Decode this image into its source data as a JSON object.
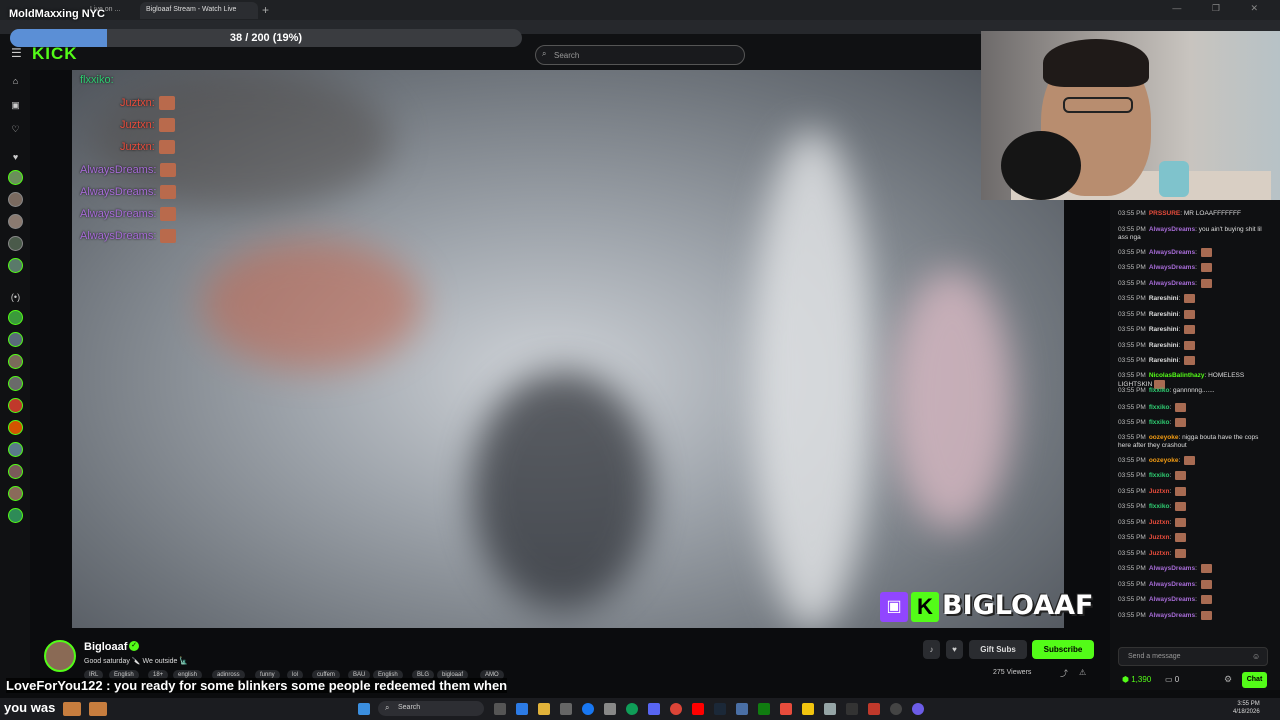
{
  "overlay": {
    "title": "MoldMaxxing NYC",
    "progress_label": "38 / 200 (19%)",
    "progress_fraction": 0.19
  },
  "browser": {
    "tabs": [
      {
        "label": "Live on ..."
      },
      {
        "label": "Bigloaaf Stream - Watch Live"
      }
    ],
    "new_tab": "+",
    "window_controls": "— ❐ ✕"
  },
  "kick": {
    "logo": "KICK",
    "search_placeholder": "Search"
  },
  "video_overlay_chat": [
    {
      "user": "flxxiko",
      "color": "#2ecc71",
      "suffix": ":"
    },
    {
      "user": "Juztxn",
      "color": "#e74c3c",
      "suffix": ":"
    },
    {
      "user": "Juztxn",
      "color": "#e74c3c",
      "suffix": ":"
    },
    {
      "user": "Juztxn",
      "color": "#e74c3c",
      "suffix": ":"
    },
    {
      "user": "AlwaysDreams",
      "color": "#9b59b6",
      "suffix": ":"
    },
    {
      "user": "AlwaysDreams",
      "color": "#9b59b6",
      "suffix": ":"
    },
    {
      "user": "AlwaysDreams",
      "color": "#9b59b6",
      "suffix": ":"
    },
    {
      "user": "AlwaysDreams",
      "color": "#9b59b6",
      "suffix": ":"
    }
  ],
  "video_badge": {
    "handle": "BIGLOAAF",
    "k": "K"
  },
  "chat": {
    "messages": [
      {
        "time": "03:55 PM",
        "user": "PRSSURE",
        "color": "#e74c3c",
        "text": "MR LOAAFFFFFFF",
        "emote": false
      },
      {
        "time": "03:55 PM",
        "user": "AlwaysDreams",
        "color": "#a66bd6",
        "text": "you ain't buying shit lil ass nga",
        "emote": false
      },
      {
        "time": "03:55 PM",
        "user": "AlwaysDreams",
        "color": "#a66bd6",
        "text": "",
        "emote": true
      },
      {
        "time": "03:55 PM",
        "user": "AlwaysDreams",
        "color": "#a66bd6",
        "text": "",
        "emote": true
      },
      {
        "time": "03:55 PM",
        "user": "AlwaysDreams",
        "color": "#a66bd6",
        "text": "",
        "emote": true
      },
      {
        "time": "03:55 PM",
        "user": "Rareshini",
        "color": "#dddddd",
        "text": "",
        "emote": true
      },
      {
        "time": "03:55 PM",
        "user": "Rareshini",
        "color": "#dddddd",
        "text": "",
        "emote": true
      },
      {
        "time": "03:55 PM",
        "user": "Rareshini",
        "color": "#dddddd",
        "text": "",
        "emote": true
      },
      {
        "time": "03:55 PM",
        "user": "Rareshini",
        "color": "#dddddd",
        "text": "",
        "emote": true
      },
      {
        "time": "03:55 PM",
        "user": "Rareshini",
        "color": "#dddddd",
        "text": "",
        "emote": true
      },
      {
        "time": "03:55 PM",
        "user": "NicolasBalinthazy",
        "color": "#53fc18",
        "text": "HOMELESS LIGHTSKIN",
        "emote": true
      },
      {
        "time": "03:55 PM",
        "user": "flxxiko",
        "color": "#2ecc71",
        "text": "gannnnng.......",
        "emote": false
      },
      {
        "time": "03:55 PM",
        "user": "flxxiko",
        "color": "#2ecc71",
        "text": "",
        "emote": true
      },
      {
        "time": "03:55 PM",
        "user": "flxxiko",
        "color": "#2ecc71",
        "text": "",
        "emote": true
      },
      {
        "time": "03:55 PM",
        "user": "oozeyoke",
        "color": "#f39c12",
        "text": "nigga bouta have the cops here after they crashout",
        "emote": false
      },
      {
        "time": "03:55 PM",
        "user": "oozeyoke",
        "color": "#f39c12",
        "text": "",
        "emote": true
      },
      {
        "time": "03:55 PM",
        "user": "flxxiko",
        "color": "#2ecc71",
        "text": "",
        "emote": true
      },
      {
        "time": "03:55 PM",
        "user": "Juztxn",
        "color": "#e74c3c",
        "text": "",
        "emote": true
      },
      {
        "time": "03:55 PM",
        "user": "flxxiko",
        "color": "#2ecc71",
        "text": "",
        "emote": true
      },
      {
        "time": "03:55 PM",
        "user": "Juztxn",
        "color": "#e74c3c",
        "text": "",
        "emote": true
      },
      {
        "time": "03:55 PM",
        "user": "Juztxn",
        "color": "#e74c3c",
        "text": "",
        "emote": true
      },
      {
        "time": "03:55 PM",
        "user": "Juztxn",
        "color": "#e74c3c",
        "text": "",
        "emote": true
      },
      {
        "time": "03:55 PM",
        "user": "AlwaysDreams",
        "color": "#a66bd6",
        "text": "",
        "emote": true
      },
      {
        "time": "03:55 PM",
        "user": "AlwaysDreams",
        "color": "#a66bd6",
        "text": "",
        "emote": true
      },
      {
        "time": "03:55 PM",
        "user": "AlwaysDreams",
        "color": "#a66bd6",
        "text": "",
        "emote": true
      },
      {
        "time": "03:55 PM",
        "user": "AlwaysDreams",
        "color": "#a66bd6",
        "text": "",
        "emote": true
      }
    ],
    "input_placeholder": "Send a message",
    "kicks": "1,390",
    "points": "0",
    "chat_button": "Chat"
  },
  "streamer": {
    "name": "Bigloaaf",
    "title": "Good saturday 🔪 We outside 🗽",
    "tags": [
      "IRL",
      "English",
      "18+",
      "english",
      "adinross",
      "funny",
      "lol",
      "cuffem",
      "BAU",
      "English",
      "BLG",
      "bigloaaf",
      "AMO"
    ],
    "gift_subs": "Gift Subs",
    "subscribe": "Subscribe",
    "viewers": "275 Viewers"
  },
  "caption": {
    "line1": "LoveForYou122 : you ready for some blinkers some people redeemed them when",
    "line2": "you was"
  },
  "taskbar": {
    "search_label": "Search",
    "clock_time": "3:55 PM",
    "clock_date": "4/18/2026"
  },
  "colors": {
    "kick_green": "#53fc18",
    "progress": "#5b8fd6"
  }
}
